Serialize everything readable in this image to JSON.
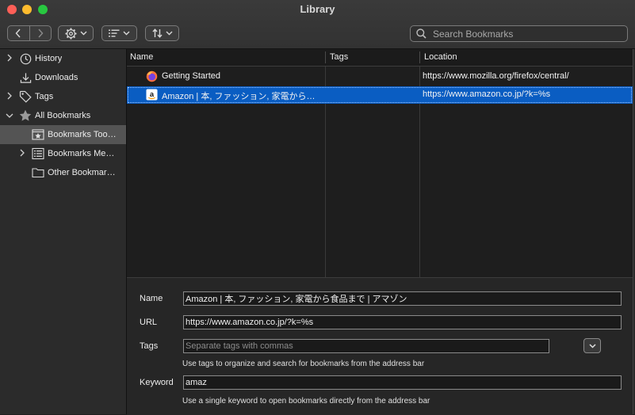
{
  "window": {
    "title": "Library"
  },
  "toolbar": {
    "search_placeholder": "Search Bookmarks"
  },
  "sidebar": {
    "items": [
      {
        "label": "History",
        "icon": "clock-icon",
        "expandable": true,
        "expanded": false,
        "selected": false
      },
      {
        "label": "Downloads",
        "icon": "download-icon",
        "expandable": false,
        "expanded": false,
        "selected": false
      },
      {
        "label": "Tags",
        "icon": "tag-icon",
        "expandable": true,
        "expanded": false,
        "selected": false
      },
      {
        "label": "All Bookmarks",
        "icon": "star-icon",
        "expandable": true,
        "expanded": true,
        "selected": false
      },
      {
        "label": "Bookmarks Too…",
        "icon": "bookmarks-toolbar-icon",
        "expandable": false,
        "expanded": false,
        "selected": true
      },
      {
        "label": "Bookmarks Me…",
        "icon": "bookmarks-menu-icon",
        "expandable": true,
        "expanded": false,
        "selected": false
      },
      {
        "label": "Other Bookmar…",
        "icon": "folder-icon",
        "expandable": false,
        "expanded": false,
        "selected": false
      }
    ]
  },
  "table": {
    "columns": [
      "Name",
      "Tags",
      "Location"
    ],
    "rows": [
      {
        "name": "Getting Started",
        "tags": "",
        "location": "https://www.mozilla.org/firefox/central/",
        "icon": "firefox-icon",
        "selected": false
      },
      {
        "name": "Amazon | 本, ファッション, 家電から…",
        "tags": "",
        "location": "https://www.amazon.co.jp/?k=%s",
        "icon": "amazon-icon",
        "selected": true
      }
    ]
  },
  "details": {
    "name_label": "Name",
    "name_value": "Amazon | 本, ファッション, 家電から食品まで | アマゾン",
    "url_label": "URL",
    "url_value": "https://www.amazon.co.jp/?k=%s",
    "tags_label": "Tags",
    "tags_placeholder": "Separate tags with commas",
    "tags_hint": "Use tags to organize and search for bookmarks from the address bar",
    "keyword_label": "Keyword",
    "keyword_value": "amaz",
    "keyword_hint": "Use a single keyword to open bookmarks directly from the address bar"
  },
  "colors": {
    "selection": "#0a5dc2",
    "sidebar_selection": "#545454",
    "close": "#fe5f57",
    "minimize": "#febc2e",
    "maximize": "#28c840"
  }
}
